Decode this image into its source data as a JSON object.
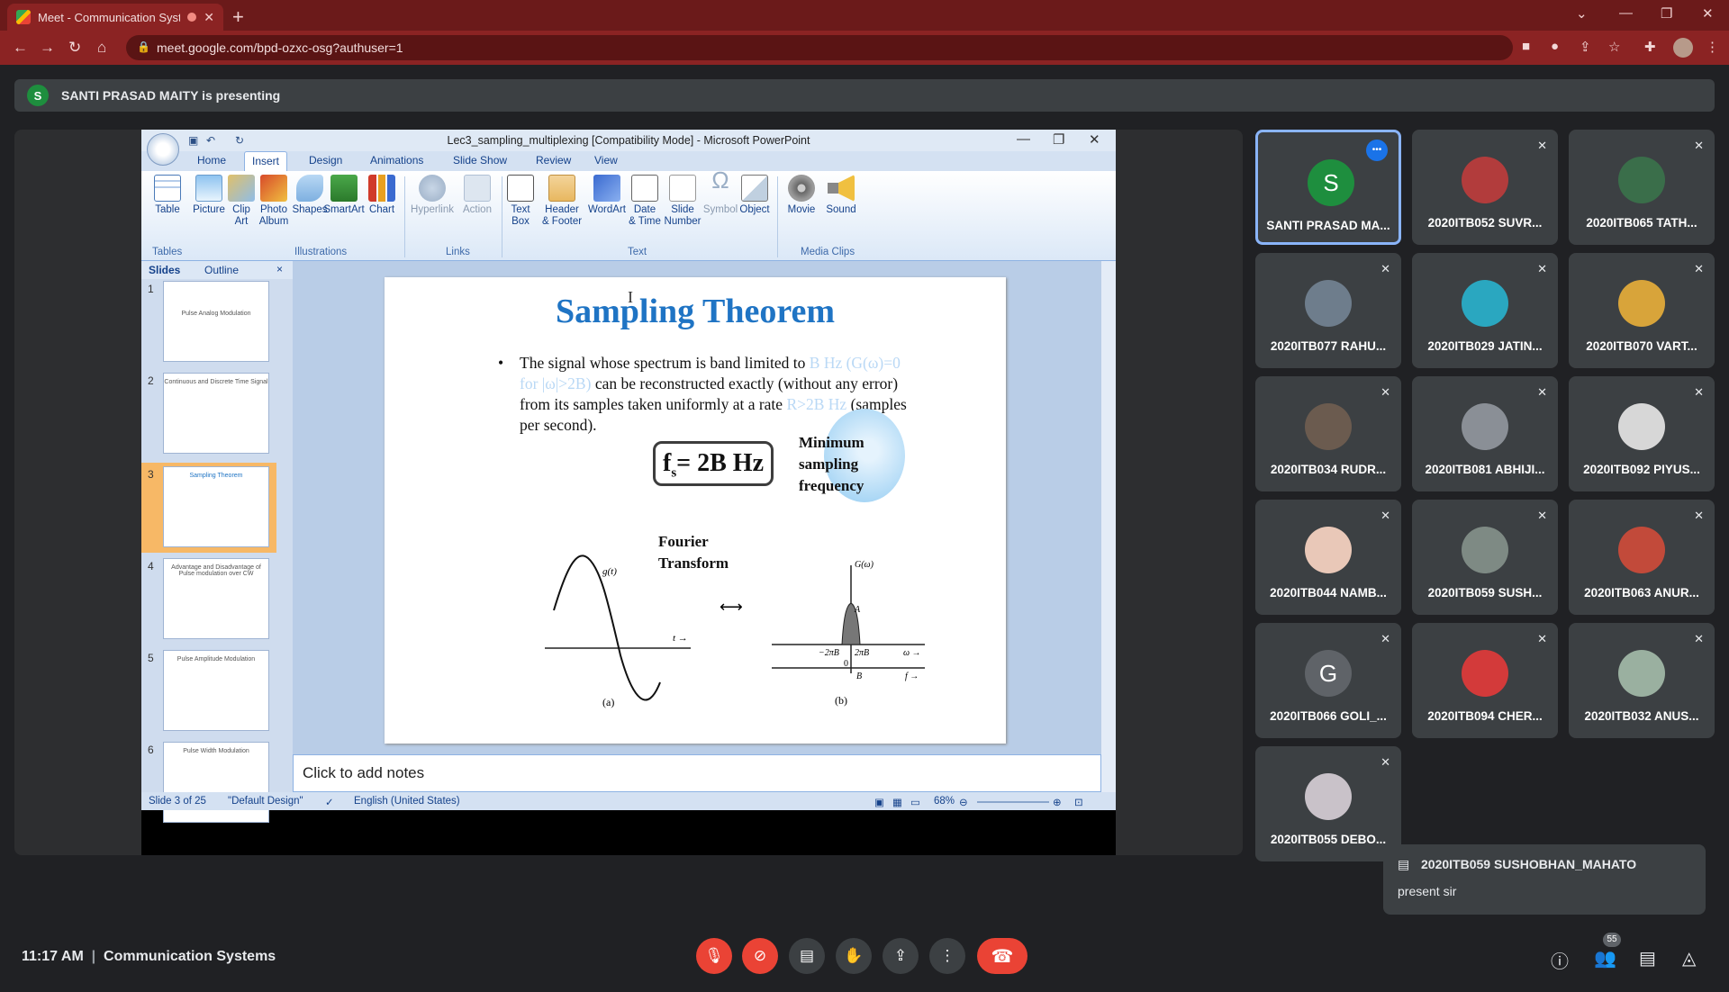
{
  "browser": {
    "tab_title": "Meet - Communication Syst",
    "tab_close": "✕",
    "new_tab": "+",
    "url": "meet.google.com/bpd-ozxc-osg?authuser=1"
  },
  "meet": {
    "presenting_initial": "S",
    "presenting_text": "SANTI PRASAD MAITY is presenting",
    "clock": "11:17 AM",
    "separator": "|",
    "meeting_name": "Communication Systems",
    "people_count": "55",
    "chat": {
      "sender": "2020ITB059 SUSHOBHAN_MAHATO",
      "message": "present sir"
    },
    "participants": [
      {
        "name": "SANTI PRASAD MA...",
        "initial": "S",
        "avatar_color": "#1e8e3e",
        "speaking": true
      },
      {
        "name": "2020ITB052 SUVR...",
        "initial": "",
        "avatar_color": "#b23c3c",
        "speaking": false
      },
      {
        "name": "2020ITB065 TATH...",
        "initial": "",
        "avatar_color": "#3a6e4a",
        "speaking": false
      },
      {
        "name": "2020ITB077 RAHU...",
        "initial": "",
        "avatar_color": "#6e7d8c",
        "speaking": false
      },
      {
        "name": "2020ITB029 JATIN...",
        "initial": "",
        "avatar_color": "#2aa7c0",
        "speaking": false
      },
      {
        "name": "2020ITB070 VART...",
        "initial": "",
        "avatar_color": "#d8a43a",
        "speaking": false
      },
      {
        "name": "2020ITB034 RUDR...",
        "initial": "",
        "avatar_color": "#6b5b4f",
        "speaking": false
      },
      {
        "name": "2020ITB081 ABHIJI...",
        "initial": "",
        "avatar_color": "#8a8f96",
        "speaking": false
      },
      {
        "name": "2020ITB092 PIYUS...",
        "initial": "",
        "avatar_color": "#d7d7d7",
        "speaking": false
      },
      {
        "name": "2020ITB044 NAMB...",
        "initial": "",
        "avatar_color": "#e9c8b8",
        "speaking": false
      },
      {
        "name": "2020ITB059 SUSH...",
        "initial": "",
        "avatar_color": "#7e8a84",
        "speaking": false
      },
      {
        "name": "2020ITB063 ANUR...",
        "initial": "",
        "avatar_color": "#c24a3a",
        "speaking": false
      },
      {
        "name": "2020ITB066 GOLI_...",
        "initial": "G",
        "avatar_color": "#5f6368",
        "speaking": false
      },
      {
        "name": "2020ITB094 CHER...",
        "initial": "",
        "avatar_color": "#d33a3a",
        "speaking": false
      },
      {
        "name": "2020ITB032 ANUS...",
        "initial": "",
        "avatar_color": "#9ab0a0",
        "speaking": false
      },
      {
        "name": "2020ITB055 DEBO...",
        "initial": "",
        "avatar_color": "#c9c2c9",
        "speaking": false
      }
    ]
  },
  "ppt": {
    "title": "Lec3_sampling_multiplexing [Compatibility Mode] - Microsoft PowerPoint",
    "tabs": [
      "Home",
      "Insert",
      "Design",
      "Animations",
      "Slide Show",
      "Review",
      "View"
    ],
    "active_tab": "Insert",
    "ribbon": {
      "buttons": [
        "Table",
        "Picture",
        "Clip\nArt",
        "Photo\nAlbum",
        "Shapes",
        "SmartArt",
        "Chart",
        "Hyperlink",
        "Action",
        "Text\nBox",
        "Header\n& Footer",
        "WordArt",
        "Date\n& Time",
        "Slide\nNumber",
        "Symbol",
        "Object",
        "Movie",
        "Sound"
      ],
      "groups": [
        "Tables",
        "Illustrations",
        "Links",
        "Text",
        "Media Clips"
      ]
    },
    "panel_tabs": [
      "Slides",
      "Outline"
    ],
    "panel_close": "×",
    "thumbnails": [
      {
        "num": "1",
        "text": "Pulse Analog Modulation"
      },
      {
        "num": "2",
        "text": "Continuous and Discrete Time Signal"
      },
      {
        "num": "3",
        "text": "Sampling Theorem"
      },
      {
        "num": "4",
        "text": "Advantage and Disadvantage of Pulse modulation over CW"
      },
      {
        "num": "5",
        "text": "Pulse Amplitude Modulation"
      },
      {
        "num": "6",
        "text": "Pulse Width Modulation"
      }
    ],
    "slide": {
      "title": "Sampling Theorem",
      "bullet_a": "The signal whose spectrum is band limited to ",
      "bullet_b_faint": "B Hz (G(ω)=0 for |ω|>2B)",
      "bullet_c": " can be reconstructed exactly (without any error) from its samples taken uniformly at a rate ",
      "bullet_d_faint": "R>2B Hz",
      "bullet_e": " (samples per second).",
      "fs_main": "f",
      "fs_sub": "s",
      "fs_rest": "= 2B Hz",
      "min_sampling": [
        "Minimum",
        "sampling",
        "frequency"
      ],
      "fourier": [
        "Fourier",
        "Transform"
      ],
      "fig_a_label": "(a)",
      "fig_b_label": "(b)",
      "g_t": "g(t)",
      "t_arrow": "t →",
      "G_omega": "G(ω)",
      "A_label": "A",
      "neg2piB": "−2πB",
      "pos2piB": "2πB",
      "omega_arrow": "ω →",
      "zero": "0",
      "B_label": "B",
      "f_arrow": "f →",
      "double_arrow": "⟷"
    },
    "notes_placeholder": "Click to add notes",
    "status": {
      "slide_info": "Slide 3 of 25",
      "theme": "\"Default Design\"",
      "language": "English (United States)",
      "zoom": "68%"
    }
  }
}
